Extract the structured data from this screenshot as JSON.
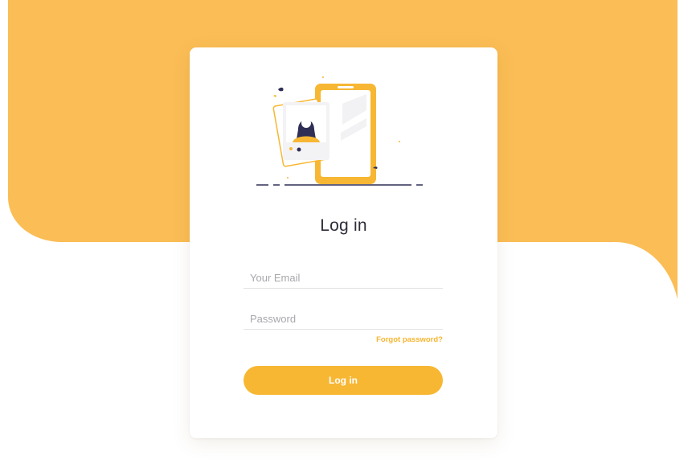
{
  "colors": {
    "background_accent": "#FBBD55",
    "button": "#F7B733",
    "link": "#F5B52F",
    "card": "#FFFFFF",
    "title_text": "#2E2E38"
  },
  "illustration": {
    "icon": "phone-profile-illustration"
  },
  "login": {
    "title": "Log in",
    "email_placeholder": "Your Email",
    "email_value": "",
    "password_placeholder": "Password",
    "password_value": "",
    "forgot_label": "Forgot password?",
    "submit_label": "Log in"
  }
}
